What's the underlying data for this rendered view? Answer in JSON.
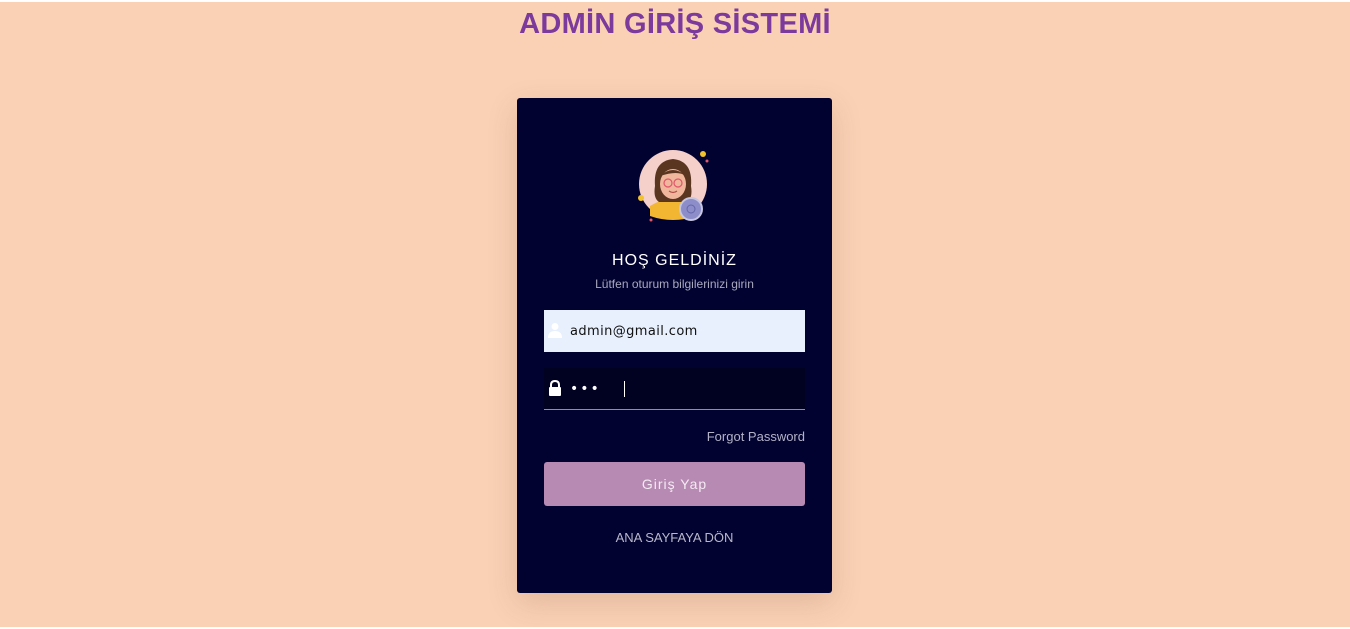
{
  "page": {
    "title": "ADMİN GİRİŞ SİSTEMİ",
    "background_color": "#fad1b5",
    "title_color": "#7b3a9c"
  },
  "login_card": {
    "background_color": "#020230",
    "avatar_icon": "woman-avatar-icon",
    "welcome": "HOŞ GELDİNİZ",
    "subtitle": "Lütfen oturum bilgilerinizi girin",
    "email": {
      "icon": "user-icon",
      "value": "admin@gmail.com"
    },
    "password": {
      "icon": "lock-icon",
      "masked_value": "•••"
    },
    "forgot_password": "Forgot Password",
    "submit_label": "Giriş Yap",
    "submit_color": "#b68ab2",
    "back_link": "ANA SAYFAYA DÖN"
  }
}
